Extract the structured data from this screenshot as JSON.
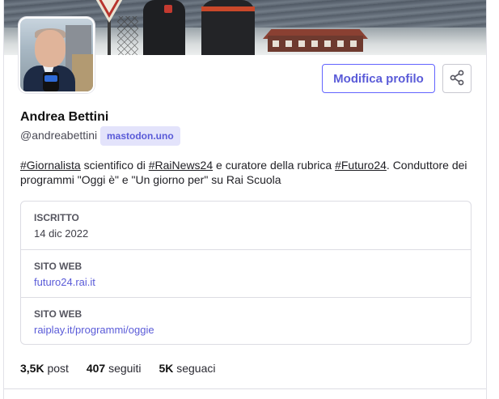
{
  "profile": {
    "display_name": "Andrea Bettini",
    "handle": "@andreabettini",
    "server": "mastodon.uno",
    "edit_label": "Modifica profilo",
    "bio": {
      "tag1": "#Giornalista",
      "text1": " scientifico di ",
      "tag2": "#RaiNews24",
      "text2": " e curatore della rubrica ",
      "tag3": "#Futuro24",
      "text3": ". Conduttore dei programmi \"Oggi è\" e \"Un giorno per\" su Rai Scuola"
    },
    "fields": [
      {
        "label": "ISCRITTO",
        "value": "14 dic 2022"
      },
      {
        "label": "SITO WEB",
        "value": "futuro24.rai.it"
      },
      {
        "label": "SITO WEB",
        "value": "raiplay.it/programmi/oggie"
      }
    ],
    "stats": {
      "posts_count": "3,5K",
      "posts_label": "post",
      "following_count": "407",
      "following_label": "seguiti",
      "followers_count": "5K",
      "followers_label": "seguaci"
    }
  },
  "icons": {
    "share": "share-icon"
  },
  "colors": {
    "accent": "#6364ff",
    "badge_bg": "#e3e3fb",
    "border": "#dcdce3"
  }
}
